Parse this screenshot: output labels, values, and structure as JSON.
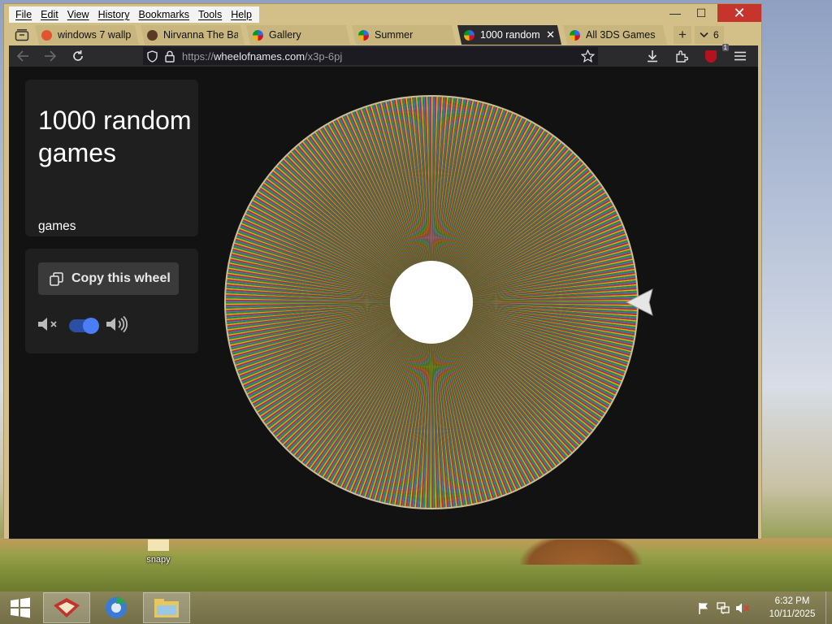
{
  "desktop": {
    "icon_label": "snapy"
  },
  "window": {
    "menu": [
      "File",
      "Edit",
      "View",
      "History",
      "Bookmarks",
      "Tools",
      "Help"
    ],
    "controls": {
      "minimize": "—",
      "maximize": "☐",
      "close": "✕"
    }
  },
  "tabs": [
    {
      "title": "windows 7 wallp",
      "favicon_color": "#e2542f",
      "active": false
    },
    {
      "title": "Nirvanna The Ba",
      "favicon_color": "#5a3a22",
      "active": false
    },
    {
      "title": "Gallery",
      "favicon_color": "#3d7be0",
      "active": false
    },
    {
      "title": "Summer",
      "favicon_color": "#3d7be0",
      "active": false
    },
    {
      "title": "1000 random",
      "favicon_color": "#3d7be0",
      "active": true
    },
    {
      "title": "All 3DS Games",
      "favicon_color": "#3d7be0",
      "active": false
    }
  ],
  "tab_count": "6",
  "navbar": {
    "url_scheme": "https://",
    "url_host": "wheelofnames.com",
    "url_path": "/x3p-6pj",
    "ublock_badge": "1"
  },
  "page": {
    "title": "1000 random games",
    "description": "games",
    "copy_button_label": "Copy this wheel",
    "sound_enabled": true
  },
  "wheel": {
    "entry_count": 1000,
    "palette": [
      "#3369e8",
      "#d50f25",
      "#eeb211",
      "#009925"
    ],
    "center_color": "#ffffff",
    "pointer_color": "#e0e0e0"
  },
  "taskbar": {
    "apps": [
      "browser-app-icon",
      "chrome-app-icon",
      "file-explorer-icon"
    ],
    "clock_time": "6:32 PM",
    "clock_date": "10/11/2025"
  }
}
